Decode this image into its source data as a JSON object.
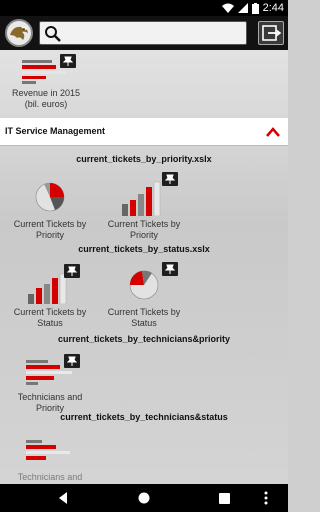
{
  "status_bar": {
    "time": "2:44"
  },
  "toolbar": {
    "search": {
      "placeholder": ""
    }
  },
  "top_partial_tile": {
    "label": "Revenue in 2015 (bil. euros)"
  },
  "section": {
    "title": "IT Service Management",
    "files": [
      {
        "name": "current_tickets_by_priority.xslx",
        "tiles": [
          {
            "label": "Current Tickets by Priority"
          },
          {
            "label": "Current Tickets by Priority"
          }
        ]
      },
      {
        "name": "current_tickets_by_status.xslx",
        "tiles": [
          {
            "label": "Current Tickets by Status"
          },
          {
            "label": "Current Tickets by Status"
          }
        ]
      },
      {
        "name": "current_tickets_by_technicians&priority",
        "tiles": [
          {
            "label": "Technicians and Priority"
          }
        ]
      },
      {
        "name": "current_tickets_by_technicians&status",
        "tiles": [
          {
            "label": "Technicians and Status"
          }
        ]
      }
    ]
  },
  "colors": {
    "accent": "#d40000",
    "toolbar": "#121212",
    "status_bar": "#000000"
  }
}
